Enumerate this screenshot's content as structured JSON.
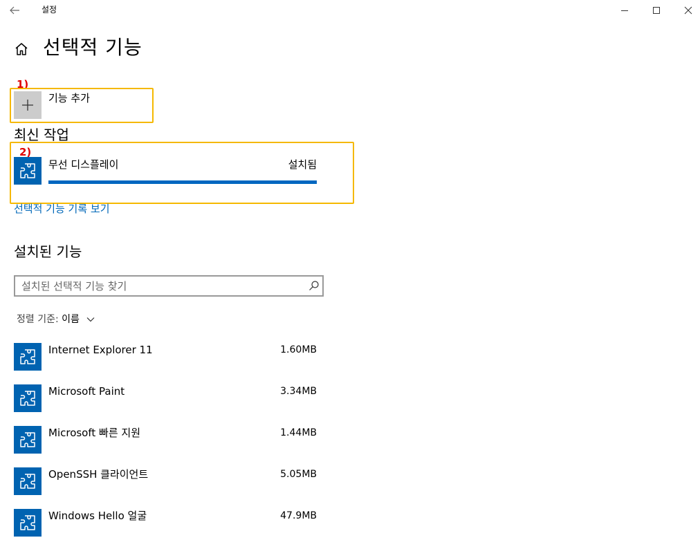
{
  "window": {
    "title": "설정"
  },
  "header": {
    "title": "선택적 기능"
  },
  "annotations": {
    "one": "1)",
    "two": "2)"
  },
  "add_feature": {
    "label": "기능 추가"
  },
  "recent": {
    "title": "최신 작업",
    "item": {
      "name": "무선 디스플레이",
      "status": "설치됨",
      "progress_percent": 100
    },
    "history_link": "선택적 기능 기록 보기"
  },
  "installed": {
    "title": "설치된 기능",
    "search_placeholder": "설치된 선택적 기능 찾기",
    "sort_label": "정렬 기준:",
    "sort_value": "이름",
    "items": [
      {
        "name": "Internet Explorer 11",
        "size": "1.60MB"
      },
      {
        "name": "Microsoft Paint",
        "size": "3.34MB"
      },
      {
        "name": "Microsoft 빠른 지원",
        "size": "1.44MB"
      },
      {
        "name": "OpenSSH 클라이언트",
        "size": "5.05MB"
      },
      {
        "name": "Windows Hello 얼굴",
        "size": "47.9MB"
      }
    ]
  },
  "colors": {
    "accent": "#0063b1",
    "annotation_box": "#f5b800",
    "annotation_text": "#e00000",
    "link": "#0067b8"
  },
  "icons": {
    "back": "arrow-left",
    "home": "home",
    "add": "plus",
    "feature": "puzzle-piece",
    "search": "magnifier",
    "sort": "chevron-down"
  }
}
